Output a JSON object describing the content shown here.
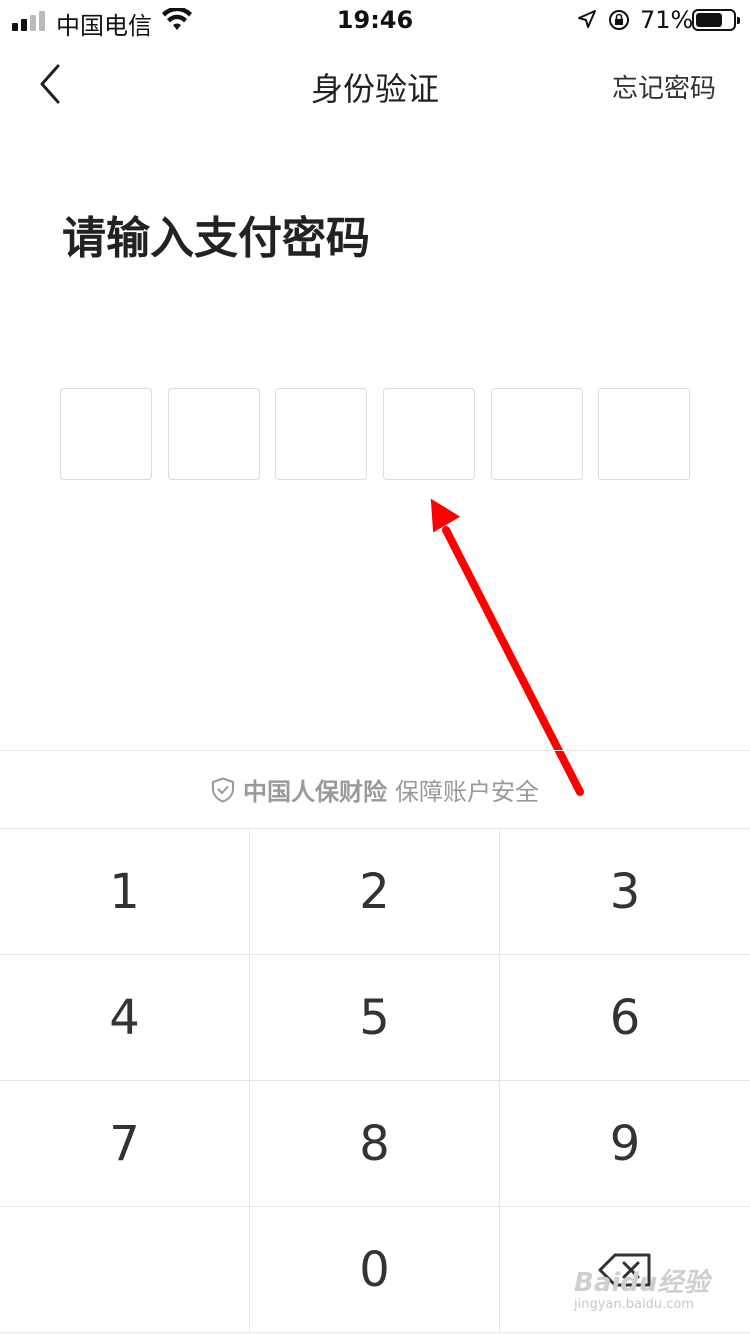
{
  "status_bar": {
    "carrier": "中国电信",
    "time": "19:46",
    "battery": "71%",
    "battery_level": 0.71
  },
  "nav": {
    "title": "身份验证",
    "forget_password": "忘记密码"
  },
  "prompt": "请输入支付密码",
  "password_boxes": [
    "",
    "",
    "",
    "",
    "",
    ""
  ],
  "security": {
    "insurer": "中国人保财险",
    "tagline": "保障账户安全"
  },
  "keypad": {
    "keys": [
      "1",
      "2",
      "3",
      "4",
      "5",
      "6",
      "7",
      "8",
      "9",
      "",
      "0",
      "delete"
    ]
  },
  "watermark": {
    "main": "Baidu经验",
    "sub": "jingyan.baidu.com"
  },
  "colors": {
    "annotation_arrow": "#ff0000",
    "divider": "#e6e6e6"
  }
}
